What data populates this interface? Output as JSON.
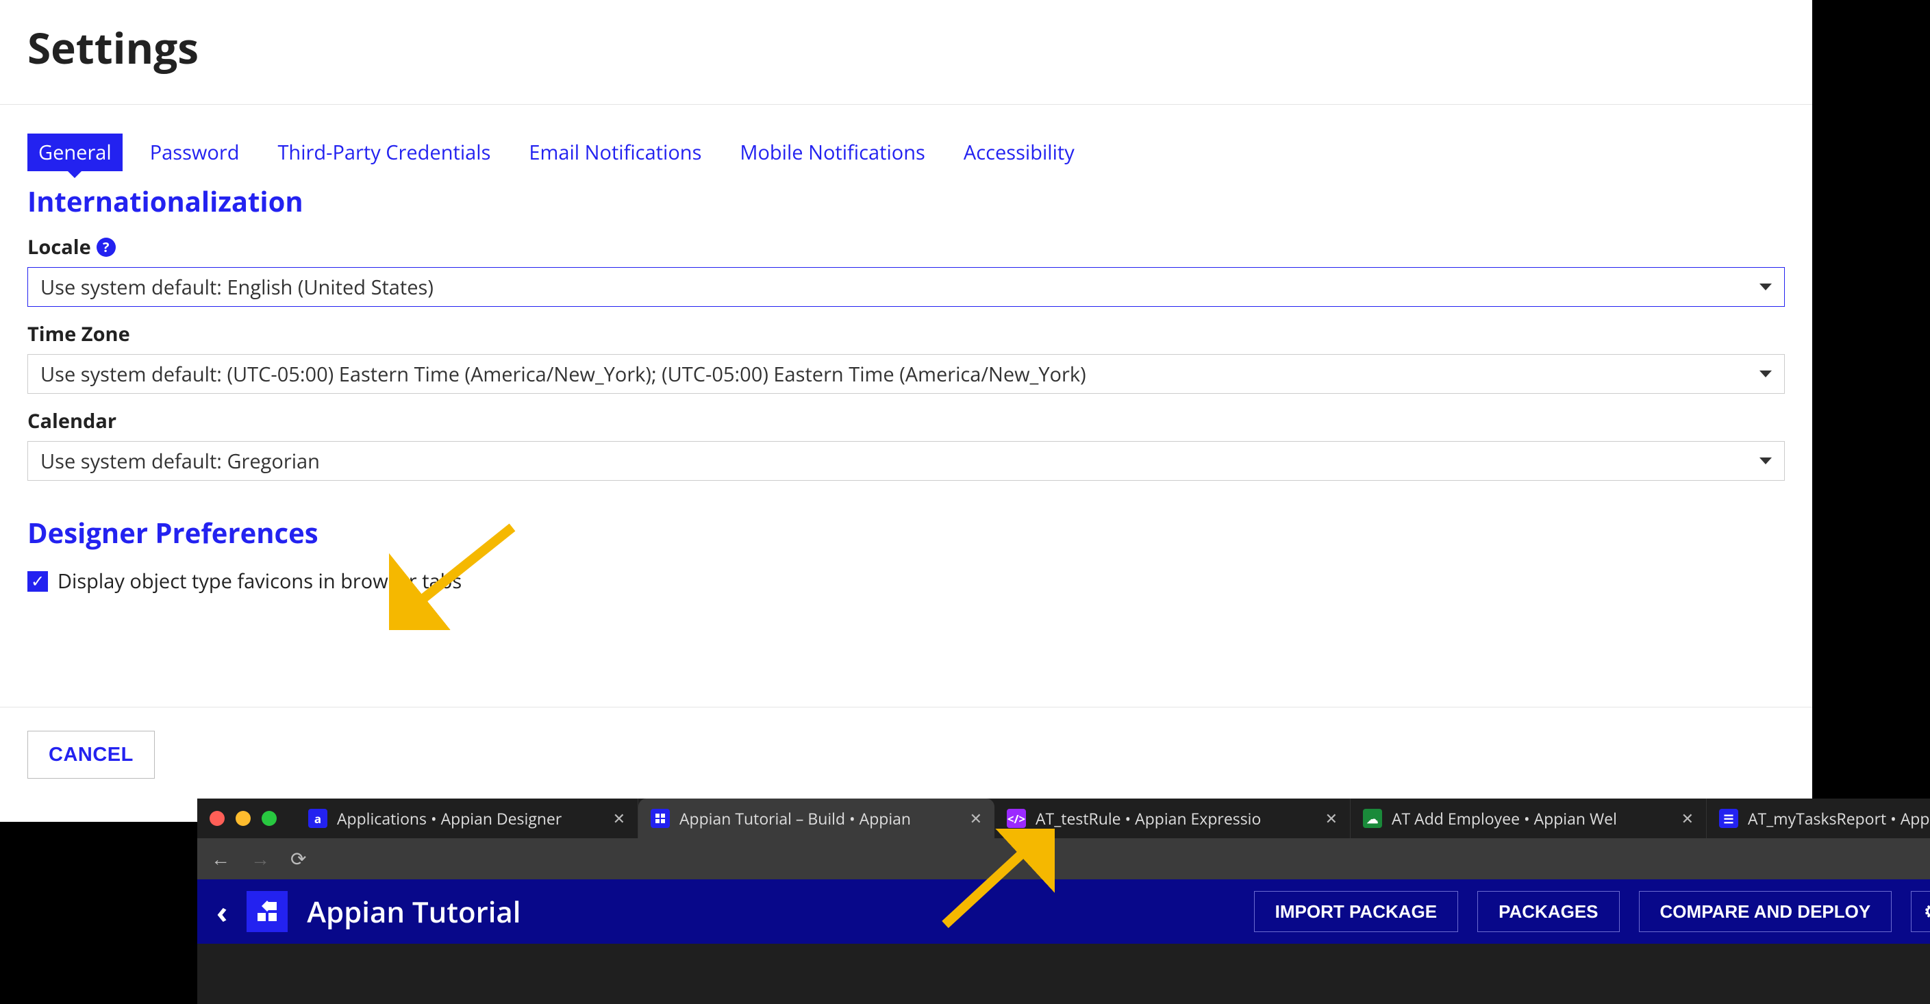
{
  "page_title": "Settings",
  "tabs": [
    {
      "label": "General",
      "active": true
    },
    {
      "label": "Password"
    },
    {
      "label": "Third-Party Credentials"
    },
    {
      "label": "Email Notifications"
    },
    {
      "label": "Mobile Notifications"
    },
    {
      "label": "Accessibility"
    }
  ],
  "sections": {
    "intl": {
      "heading": "Internationalization",
      "locale_label": "Locale",
      "locale_value": "Use system default: English (United States)",
      "timezone_label": "Time Zone",
      "timezone_value": "Use system default: (UTC-05:00) Eastern Time (America/New_York); (UTC-05:00) Eastern Time (America/New_York)",
      "calendar_label": "Calendar",
      "calendar_value": "Use system default: Gregorian"
    },
    "designer": {
      "heading": "Designer Preferences",
      "favicon_checkbox_label": "Display object type favicons in browser tabs",
      "favicon_checked": true
    }
  },
  "footer": {
    "cancel": "CANCEL"
  },
  "browser": {
    "tabs": [
      {
        "favicon": "a",
        "label": "Applications • Appian Designer"
      },
      {
        "favicon": "grid",
        "label": "Appian Tutorial – Build • Appian",
        "active": true
      },
      {
        "favicon": "code",
        "label": "AT_testRule • Appian Expressio"
      },
      {
        "favicon": "cloud",
        "label": "AT Add Employee • Appian Wel"
      },
      {
        "favicon": "list",
        "label": "AT_myTasksReport • Appian Int"
      }
    ]
  },
  "appbar": {
    "title": "Appian Tutorial",
    "buttons": [
      "IMPORT PACKAGE",
      "PACKAGES",
      "COMPARE AND DEPLOY"
    ]
  }
}
